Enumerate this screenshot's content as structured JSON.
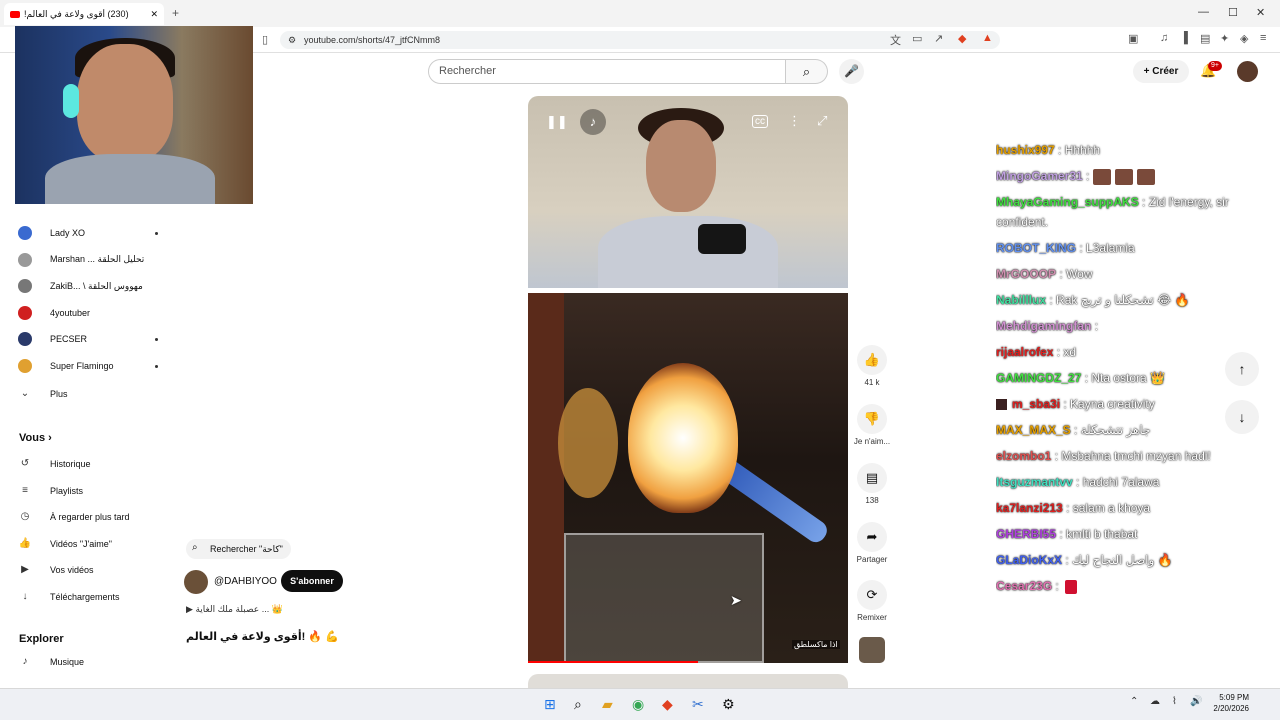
{
  "browser": {
    "tab_title": "(230) أقوى ولاعة في العالم!",
    "new_tab": "+",
    "url": "youtube.com/shorts/47_jtfCNmm8",
    "win_min": "—",
    "win_max": "☐",
    "win_close": "✕"
  },
  "header": {
    "search_placeholder": "Rechercher",
    "create_label": "Créer",
    "notif_badge": "9+"
  },
  "sidebar": {
    "subscriptions": [
      {
        "label": "Lady XO",
        "dot": true
      },
      {
        "label": "Marshan ... تحليل الحلقة",
        "dot": false
      },
      {
        "label": "ZakiB... \\ مهووس الحلقة",
        "dot": false
      },
      {
        "label": "4youtuber",
        "dot": false
      },
      {
        "label": "PECSER",
        "dot": true
      },
      {
        "label": "Super Flamingo",
        "dot": true
      }
    ],
    "more_label": "Plus",
    "you_section": "Vous",
    "you_items": [
      "Historique",
      "Playlists",
      "À regarder plus tard",
      "Vidéos \"J'aime\"",
      "Vos vidéos",
      "Téléchargements"
    ],
    "explore_section": "Explorer",
    "explore_items": [
      "Musique"
    ]
  },
  "short": {
    "search_chip": "Rechercher \"كاحة\"",
    "channel_name": "@DAHBIYOO",
    "subscribe_label": "S'abonner",
    "playlist_label": "عصبلة ملك الغاية ... 👑",
    "title": "أقوى ولاعة في العالم! 🔥 💪",
    "watermark": "اذا ماكسلطق",
    "progress_fraction": 0.53
  },
  "actions": {
    "like_count": "41 k",
    "dislike_label": "Je n'aim...",
    "comments_count": "138",
    "share_label": "Partager",
    "remix_label": "Remixer"
  },
  "chat": [
    {
      "user": "hushix997",
      "color": "#e6a000",
      "text": ": Hhhhh"
    },
    {
      "user": "MingoGamer31",
      "color": "#c0a0e0",
      "text": ":",
      "emotes": 3
    },
    {
      "user": "MhayaGaming_suppAKS",
      "color": "#40e040",
      "text": ": Zid l'energy, sir confident.",
      "wrap": true
    },
    {
      "user": "ROBOT_KING",
      "color": "#6090f0",
      "text": ": L3alamia"
    },
    {
      "user": "MrGOOOP",
      "color": "#d090b0",
      "text": ": Wow"
    },
    {
      "user": "Nabilllux",
      "color": "#40e0a0",
      "text": ": Rak تشحكلنا و تربح 😂 🔥"
    },
    {
      "user": "Mehdigamingfan",
      "color": "#d090d0",
      "text": ":"
    },
    {
      "user": "rijaalrofex",
      "color": "#e02020",
      "text": ": xd"
    },
    {
      "user": "GAMINGDZ_27",
      "color": "#40e040",
      "text": ": Nta ostora 👑"
    },
    {
      "user": "m_sba3i",
      "color": "#e02020",
      "text": ": Kayna creativity",
      "badge": true
    },
    {
      "user": "MAX_MAX_S",
      "color": "#e6a000",
      "text": ": جاهز تتشحكلة"
    },
    {
      "user": "elzombo1",
      "color": "#e05050",
      "text": ": Msbahna tmchi mzyan hadi!"
    },
    {
      "user": "Itsguzmantvv",
      "color": "#40e0c0",
      "text": ": hadchi 7alawa"
    },
    {
      "user": "ka7lanzi213",
      "color": "#e02020",
      "text": ": salam a khoya"
    },
    {
      "user": "GHERBI55",
      "color": "#b040e0",
      "text": ": kmlti b thabat"
    },
    {
      "user": "GLaDioKxX",
      "color": "#4060f0",
      "text": ": واصل النجاح ليك 🔥"
    },
    {
      "user": "Cesar23G",
      "color": "#e070b0",
      "text": ":",
      "red_icon": true
    }
  ],
  "taskbar": {
    "time": "5:09 PM",
    "date": "2/20/2026"
  }
}
